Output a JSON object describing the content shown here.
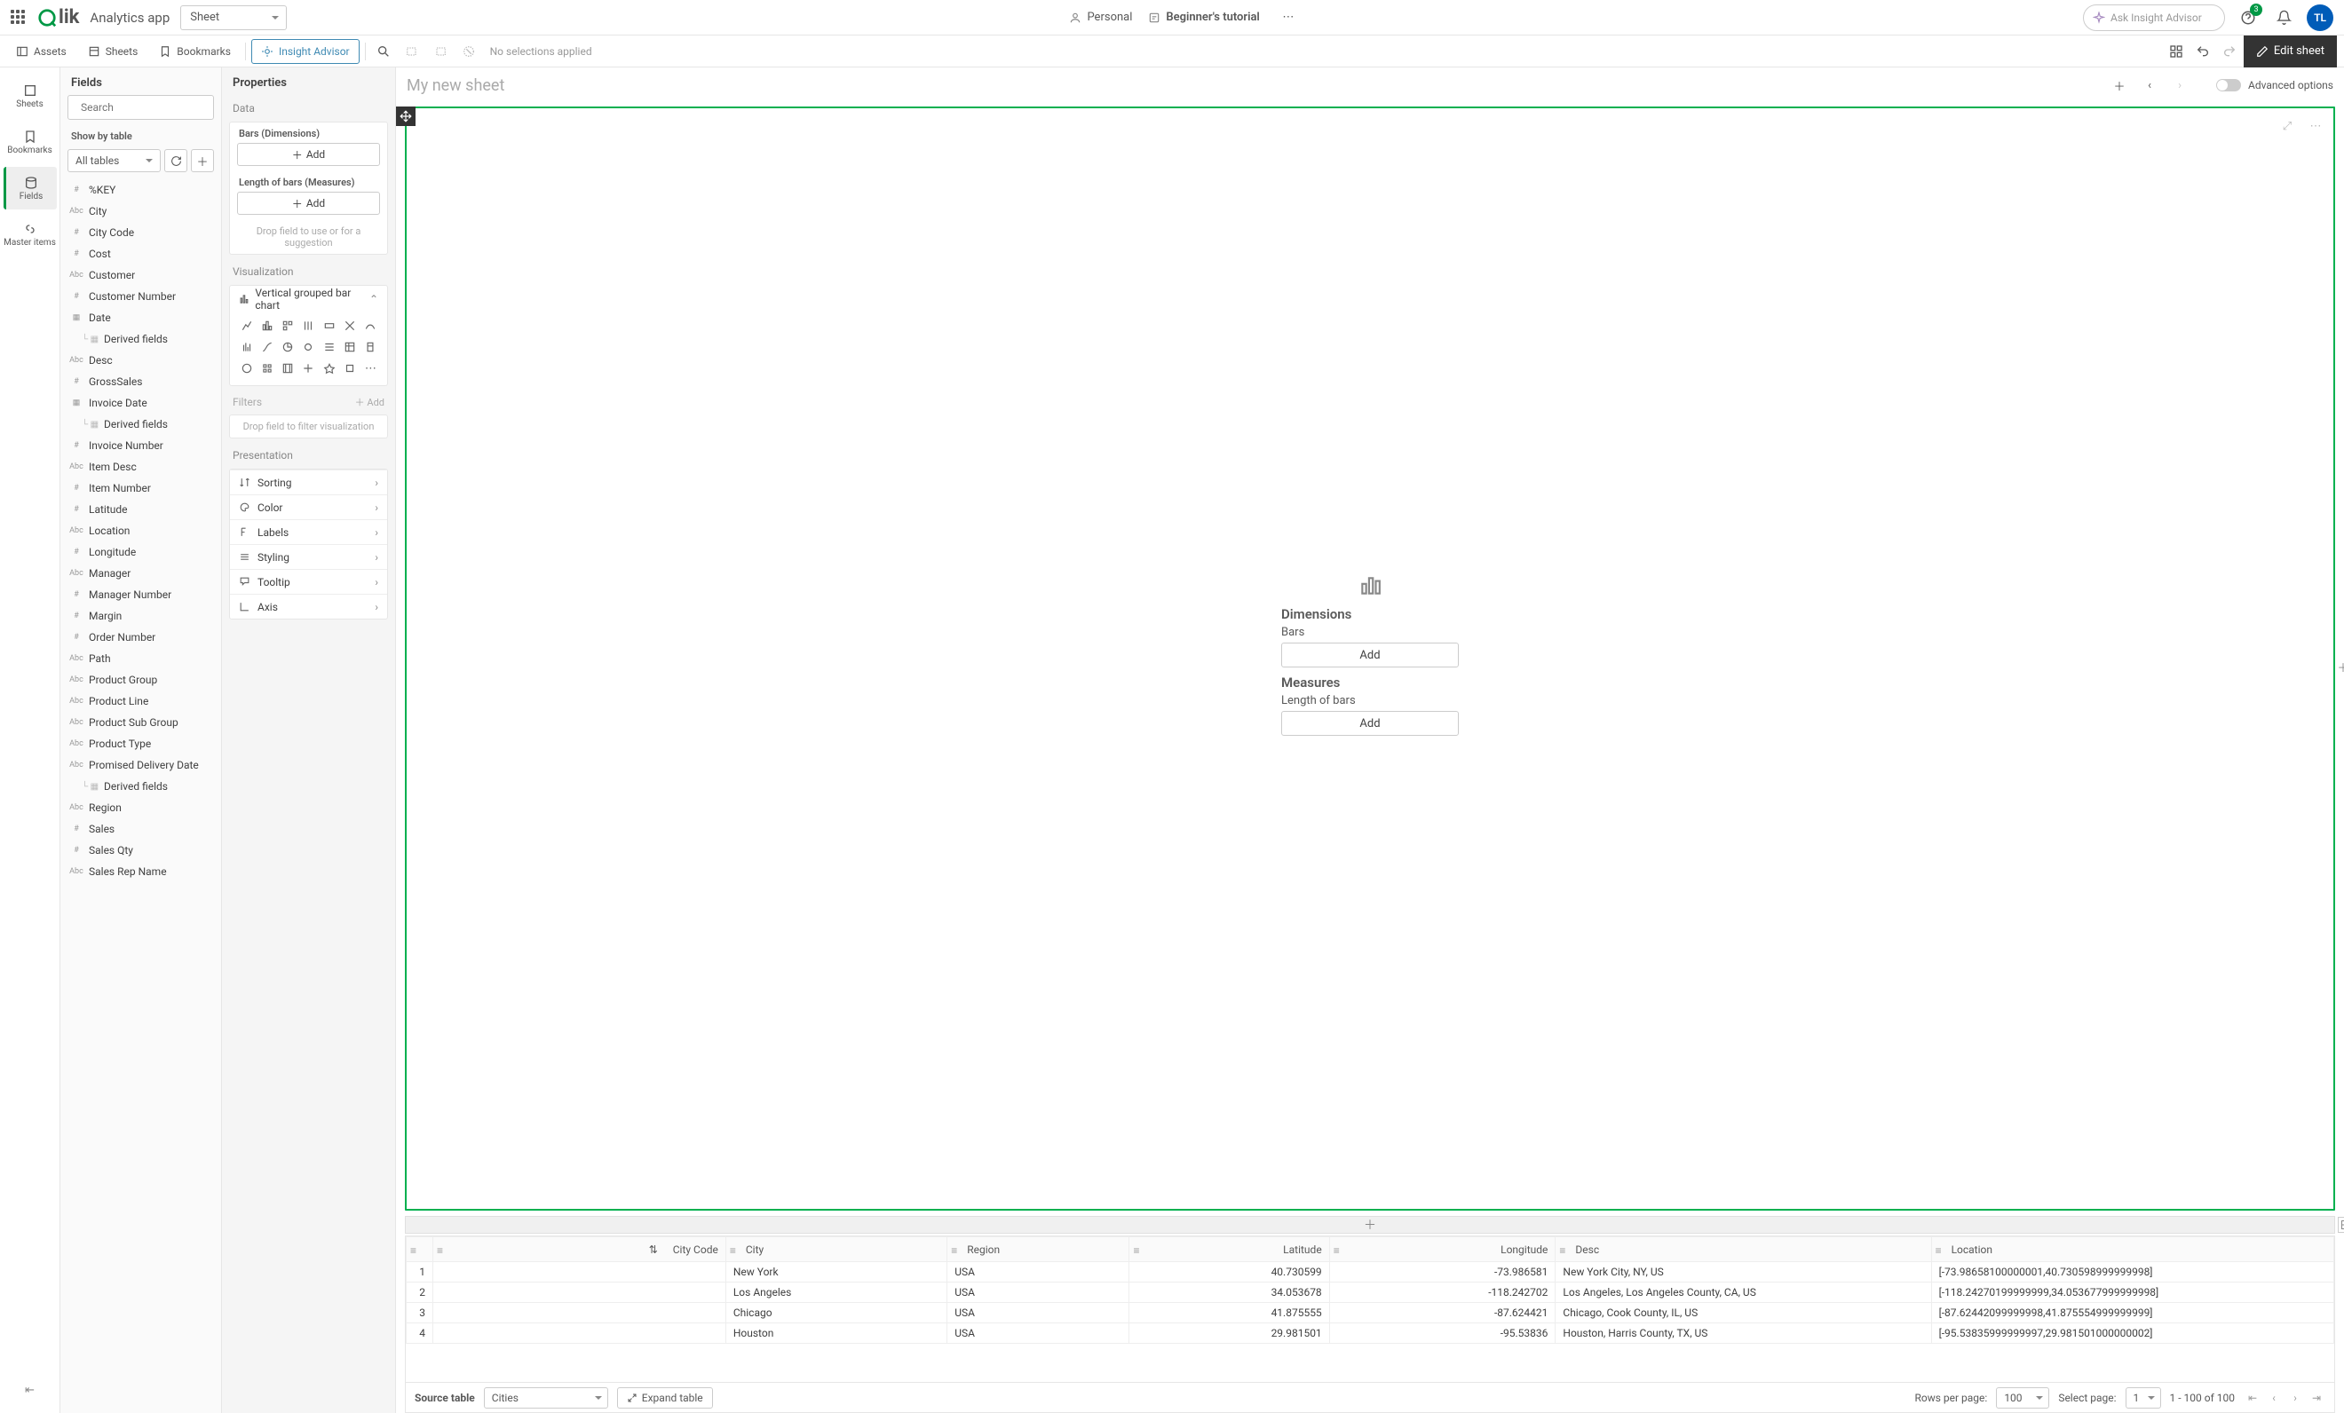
{
  "header": {
    "app_name": "Analytics app",
    "sheet_dropdown": "Sheet",
    "personal": "Personal",
    "tutorial": "Beginner's tutorial",
    "search_placeholder": "Ask Insight Advisor",
    "notification_count": "3",
    "avatar_initials": "TL"
  },
  "toolbar": {
    "assets": "Assets",
    "sheets": "Sheets",
    "bookmarks": "Bookmarks",
    "insight": "Insight Advisor",
    "no_selections": "No selections applied",
    "edit": "Edit sheet"
  },
  "rail": {
    "sheets": "Sheets",
    "bookmarks": "Bookmarks",
    "fields": "Fields",
    "master": "Master items"
  },
  "fields_panel": {
    "title": "Fields",
    "search_placeholder": "Search",
    "show_by": "Show by table",
    "tables_dropdown": "All tables",
    "items": [
      {
        "type": "#",
        "name": "%KEY"
      },
      {
        "type": "Abc",
        "name": "City"
      },
      {
        "type": "#",
        "name": "City Code"
      },
      {
        "type": "#",
        "name": "Cost"
      },
      {
        "type": "Abc",
        "name": "Customer"
      },
      {
        "type": "#",
        "name": "Customer Number"
      },
      {
        "type": "date",
        "name": "Date"
      },
      {
        "type": "nested",
        "name": "Derived fields"
      },
      {
        "type": "Abc",
        "name": "Desc"
      },
      {
        "type": "#",
        "name": "GrossSales"
      },
      {
        "type": "date",
        "name": "Invoice Date"
      },
      {
        "type": "nested",
        "name": "Derived fields"
      },
      {
        "type": "#",
        "name": "Invoice Number"
      },
      {
        "type": "Abc",
        "name": "Item Desc"
      },
      {
        "type": "#",
        "name": "Item Number"
      },
      {
        "type": "#",
        "name": "Latitude"
      },
      {
        "type": "Abc",
        "name": "Location"
      },
      {
        "type": "#",
        "name": "Longitude"
      },
      {
        "type": "Abc",
        "name": "Manager"
      },
      {
        "type": "#",
        "name": "Manager Number"
      },
      {
        "type": "#",
        "name": "Margin"
      },
      {
        "type": "#",
        "name": "Order Number"
      },
      {
        "type": "Abc",
        "name": "Path"
      },
      {
        "type": "Abc",
        "name": "Product Group"
      },
      {
        "type": "Abc",
        "name": "Product Line"
      },
      {
        "type": "Abc",
        "name": "Product Sub Group"
      },
      {
        "type": "Abc",
        "name": "Product Type"
      },
      {
        "type": "Abc",
        "name": "Promised Delivery Date"
      },
      {
        "type": "nested",
        "name": "Derived fields"
      },
      {
        "type": "Abc",
        "name": "Region"
      },
      {
        "type": "#",
        "name": "Sales"
      },
      {
        "type": "#",
        "name": "Sales Qty"
      },
      {
        "type": "Abc",
        "name": "Sales Rep Name"
      }
    ]
  },
  "properties": {
    "title": "Properties",
    "data_h": "Data",
    "bars_label": "Bars (Dimensions)",
    "measures_label": "Length of bars (Measures)",
    "add": "Add",
    "drop_hint": "Drop field to use or for a suggestion",
    "viz_h": "Visualization",
    "viz_current": "Vertical grouped bar chart",
    "filters_h": "Filters",
    "filters_add": "Add",
    "filter_hint": "Drop field to filter visualization",
    "pres_h": "Presentation",
    "pres_items": [
      "Sorting",
      "Color",
      "Labels",
      "Styling",
      "Tooltip",
      "Axis"
    ]
  },
  "canvas": {
    "sheet_title": "My new sheet",
    "adv": "Advanced options",
    "cfg_dims": "Dimensions",
    "cfg_bars": "Bars",
    "cfg_meas": "Measures",
    "cfg_len": "Length of bars",
    "add": "Add"
  },
  "preview": {
    "source_label": "Source table",
    "source_value": "Cities",
    "expand": "Expand table",
    "rows_label": "Rows per page:",
    "rows_value": "100",
    "page_label": "Select page:",
    "page_value": "1",
    "range": "1 - 100 of 100",
    "columns": [
      "",
      "City Code",
      "City",
      "Region",
      "Latitude",
      "Longitude",
      "Desc",
      "Location"
    ],
    "rows": [
      {
        "idx": "1",
        "code": "",
        "city": "New York",
        "region": "USA",
        "lat": "40.730599",
        "lon": "-73.986581",
        "desc": "New York City, NY, US",
        "loc": "[-73.98658100000001,40.730598999999998]"
      },
      {
        "idx": "2",
        "code": "",
        "city": "Los Angeles",
        "region": "USA",
        "lat": "34.053678",
        "lon": "-118.242702",
        "desc": "Los Angeles, Los Angeles County, CA, US",
        "loc": "[-118.24270199999999,34.053677999999998]"
      },
      {
        "idx": "3",
        "code": "",
        "city": "Chicago",
        "region": "USA",
        "lat": "41.875555",
        "lon": "-87.624421",
        "desc": "Chicago, Cook County, IL, US",
        "loc": "[-87.62442099999998,41.875554999999999]"
      },
      {
        "idx": "4",
        "code": "",
        "city": "Houston",
        "region": "USA",
        "lat": "29.981501",
        "lon": "-95.53836",
        "desc": "Houston, Harris County, TX, US",
        "loc": "[-95.53835999999997,29.981501000000002]"
      }
    ]
  }
}
